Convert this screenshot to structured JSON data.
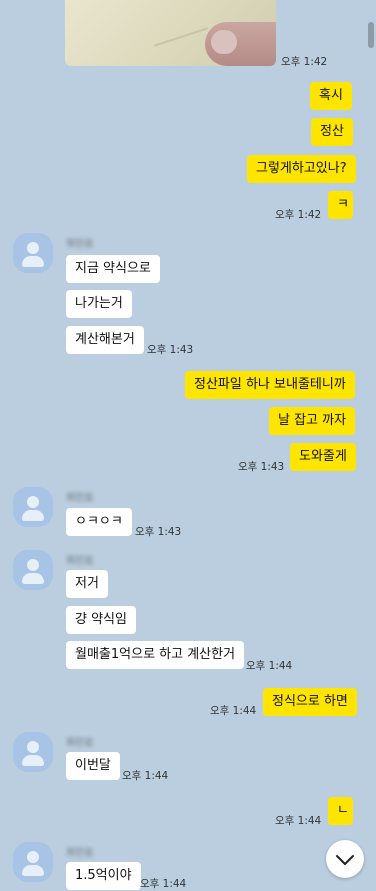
{
  "messages": {
    "m1": {
      "time": "오후 1:42"
    },
    "m2": {
      "text1": "혹시",
      "text2": "정산",
      "text3": "그렇게하고있나?",
      "text4": "ㅋ",
      "time": "오후 1:42"
    },
    "m3": {
      "sender": "최민호",
      "text1": "지금 약식으로",
      "text2": "나가는거",
      "text3": "계산해본거",
      "time": "오후 1:43"
    },
    "m4": {
      "text1": "정산파일 하나 보내줄테니까",
      "text2": "날 잡고 까자",
      "text3": "도와줄게",
      "time": "오후 1:43"
    },
    "m5": {
      "sender": "최민호",
      "text1": "ㅇㅋㅇㅋ",
      "time": "오후 1:43"
    },
    "m6": {
      "sender": "최민호",
      "text1": "저거",
      "text2": "걍 약식임",
      "text3": "월매출1억으로 하고 계산한거",
      "time": "오후 1:44"
    },
    "m7": {
      "text1": "정식으로 하면",
      "time": "오후 1:44"
    },
    "m8": {
      "sender": "최민호",
      "text1": "이번달",
      "time": "오후 1:44"
    },
    "m9": {
      "text1": "ㄴ",
      "time": "오후 1:44"
    },
    "m10": {
      "sender": "최민호",
      "text1": "1.5억이야",
      "time": "오후 1:44"
    }
  },
  "icons": {
    "avatar": "default-profile-icon",
    "scroll_down": "chevron-down-icon"
  },
  "colors": {
    "background": "#bacee0",
    "my_bubble": "#fee500",
    "other_bubble": "#ffffff"
  }
}
